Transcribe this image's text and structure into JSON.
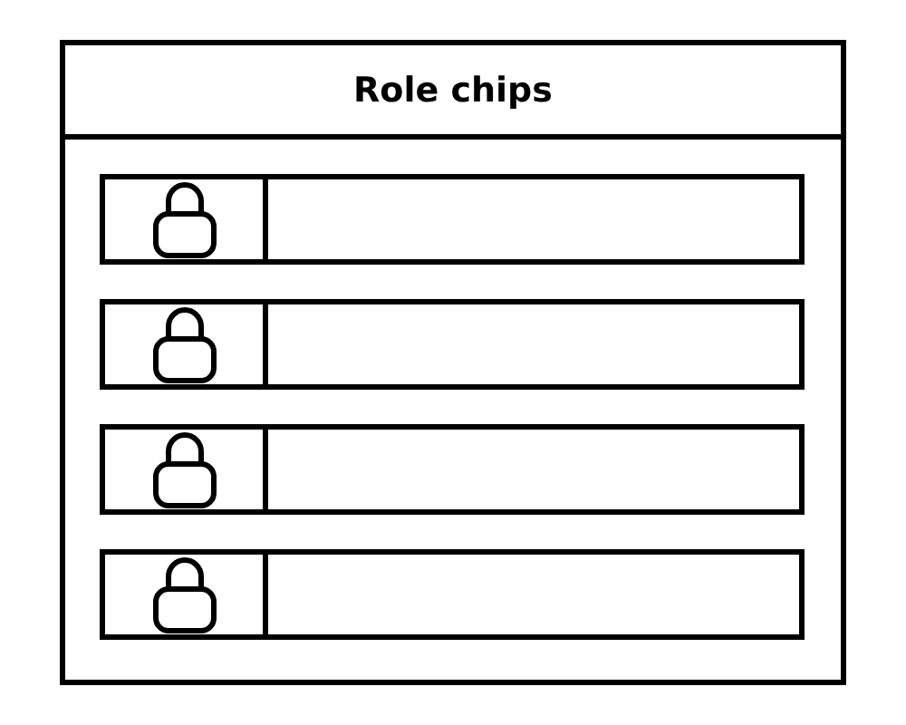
{
  "window": {
    "title": "Role chips"
  },
  "chips": [
    {
      "locked": true
    },
    {
      "locked": true
    },
    {
      "locked": true
    },
    {
      "locked": true
    }
  ]
}
